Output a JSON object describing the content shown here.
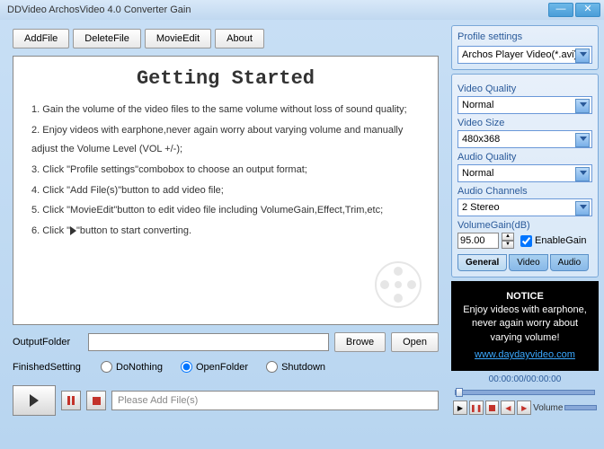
{
  "window": {
    "title": "DDVideo ArchosVideo 4.0 Converter Gain"
  },
  "toolbar": {
    "addFile": "AddFile",
    "deleteFile": "DeleteFile",
    "movieEdit": "MovieEdit",
    "about": "About"
  },
  "gettingStarted": {
    "title": "Getting Started",
    "items": [
      "Gain the volume of the video files to the same volume without loss of sound quality;",
      "Enjoy videos with earphone,never again worry about varying volume and manually adjust the Volume Level (VOL +/-);",
      "Click \"Profile settings\"combobox to choose an output format;",
      "Click \"Add File(s)\"button to add video file;",
      "Click \"MovieEdit\"button to edit video file including VolumeGain,Effect,Trim,etc;",
      "Click \" ▶ \"button to start converting."
    ]
  },
  "output": {
    "label": "OutputFolder",
    "value": "",
    "browse": "Browe",
    "open": "Open"
  },
  "finished": {
    "label": "FinishedSetting",
    "doNothing": "DoNothing",
    "openFolder": "OpenFolder",
    "shutdown": "Shutdown"
  },
  "status": {
    "text": "Please Add File(s)"
  },
  "profile": {
    "title": "Profile settings",
    "format": "Archos Player Video(*.avi)",
    "videoQualityLabel": "Video Quality",
    "videoQuality": "Normal",
    "videoSizeLabel": "Video Size",
    "videoSize": "480x368",
    "audioQualityLabel": "Audio Quality",
    "audioQuality": "Normal",
    "audioChannelsLabel": "Audio Channels",
    "audioChannels": "2 Stereo",
    "volumeGainLabel": "VolumeGain(dB)",
    "volumeGain": "95.00",
    "enableGain": "EnableGain",
    "tabs": {
      "general": "General",
      "video": "Video",
      "audio": "Audio"
    }
  },
  "notice": {
    "title": "NOTICE",
    "line1": "Enjoy videos with earphone,",
    "line2": "never again worry about",
    "line3": "varying volume!",
    "link": "www.daydayvideo.com"
  },
  "player": {
    "timecode": "00:00:00/00:00:00",
    "volume": "Volume"
  }
}
